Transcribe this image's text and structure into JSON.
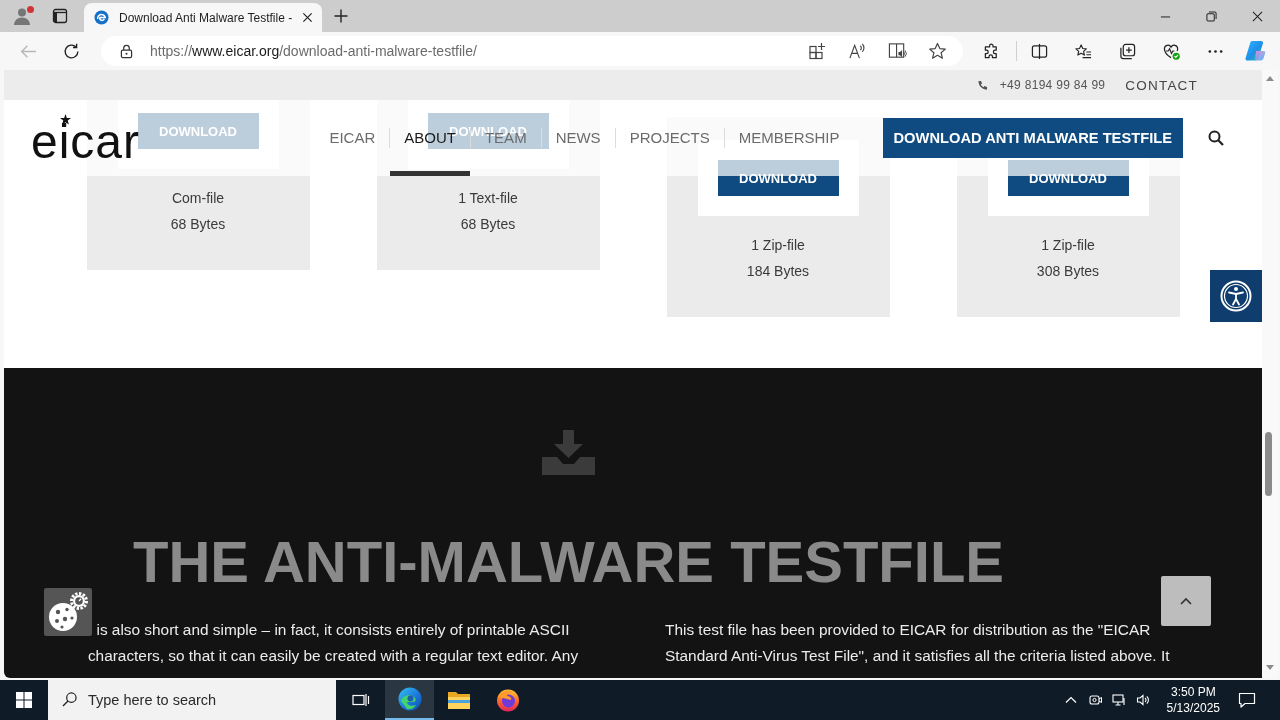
{
  "browser": {
    "profile": {
      "alert": true
    },
    "tabs": [
      {
        "title": "Download Anti Malware Testfile -",
        "selected": true
      }
    ],
    "back": {
      "disabled": true
    },
    "address": {
      "scheme": "https://",
      "host": "www.eicar.org",
      "path": "/download-anti-malware-testfile/"
    }
  },
  "site": {
    "top_bar": {
      "phone": "+49 8194 99 84 99",
      "contact": "CONTACT"
    },
    "header": {
      "logo": "eicar",
      "nav": [
        {
          "label": "EICAR",
          "selected": false
        },
        {
          "label": "ABOUT",
          "selected": true
        },
        {
          "label": "TEAM",
          "selected": false
        },
        {
          "label": "NEWS",
          "selected": false
        },
        {
          "label": "PROJECTS",
          "selected": false
        },
        {
          "label": "MEMBERSHIP",
          "selected": false
        }
      ],
      "cta": "DOWNLOAD ANTI MALWARE TESTFILE"
    },
    "files": [
      {
        "button": "DOWNLOAD",
        "type": "Com-file",
        "size": "68 Bytes"
      },
      {
        "button": "DOWNLOAD",
        "type": "1 Text-file",
        "size": "68 Bytes"
      },
      {
        "button": "DOWNLOAD",
        "type": "1 Zip-file",
        "size": "184 Bytes"
      },
      {
        "button": "DOWNLOAD",
        "type": "1 Zip-file",
        "size": "308 Bytes"
      }
    ],
    "hero": {
      "title": "THE ANTI-MALWARE TESTFILE",
      "columns": [
        {
          "lines": [
            "is also short and simple – in fact, it consists entirely of printable ASCII",
            "characters, so that it can easily be created with a regular text editor. Any"
          ]
        },
        {
          "lines": [
            "This test file has been provided to EICAR for distribution as the \"EICAR",
            "Standard Anti-Virus Test File\", and it satisfies all the criteria listed above. It"
          ]
        }
      ]
    }
  },
  "taskbar": {
    "search": {
      "placeholder": "Type here to search"
    },
    "apps": [
      {
        "kind": "browser",
        "selected": true
      },
      {
        "kind": "folder",
        "selected": false
      },
      {
        "kind": "fox",
        "selected": false
      }
    ],
    "time": "3:50 PM",
    "date": "5/13/2025"
  }
}
